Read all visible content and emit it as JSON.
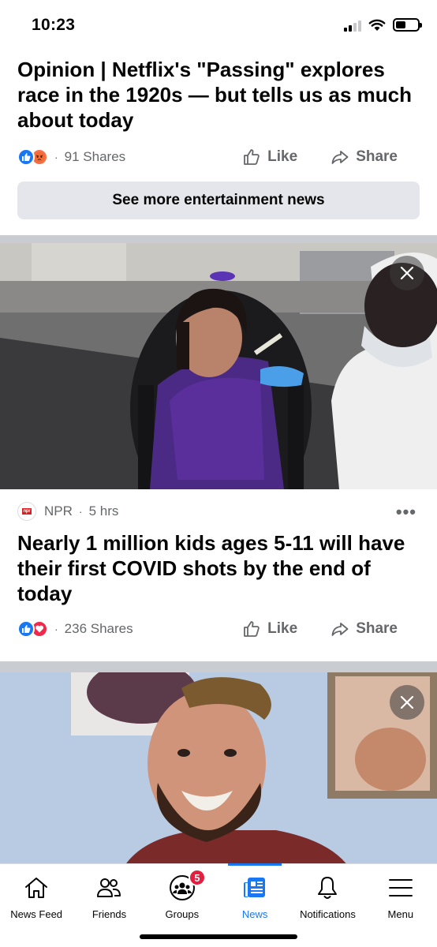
{
  "status_bar": {
    "time": "10:23"
  },
  "feed": {
    "post1": {
      "headline": "Opinion | Netflix's \"Passing\" explores race in the 1920s — but tells us as much about today",
      "shares": "91 Shares",
      "like_label": "Like",
      "share_label": "Share",
      "see_more": "See more entertainment news"
    },
    "post2": {
      "source": "NPR",
      "time": "5 hrs",
      "headline": "Nearly 1 million kids ages 5-11 will have their first COVID shots by the end of today",
      "shares": "236 Shares",
      "like_label": "Like",
      "share_label": "Share",
      "logo_text": "npr"
    }
  },
  "bottom_nav": {
    "items": [
      {
        "label": "News Feed",
        "icon": "home-icon"
      },
      {
        "label": "Friends",
        "icon": "friends-icon"
      },
      {
        "label": "Groups",
        "icon": "groups-icon",
        "badge": "5"
      },
      {
        "label": "News",
        "icon": "news-icon",
        "active": true
      },
      {
        "label": "Notifications",
        "icon": "bell-icon"
      },
      {
        "label": "Menu",
        "icon": "menu-icon"
      }
    ]
  },
  "colors": {
    "accent": "#1877f2",
    "badge": "#e41e3f",
    "separator": "#c9ccd1",
    "muted_text": "#65676b"
  }
}
